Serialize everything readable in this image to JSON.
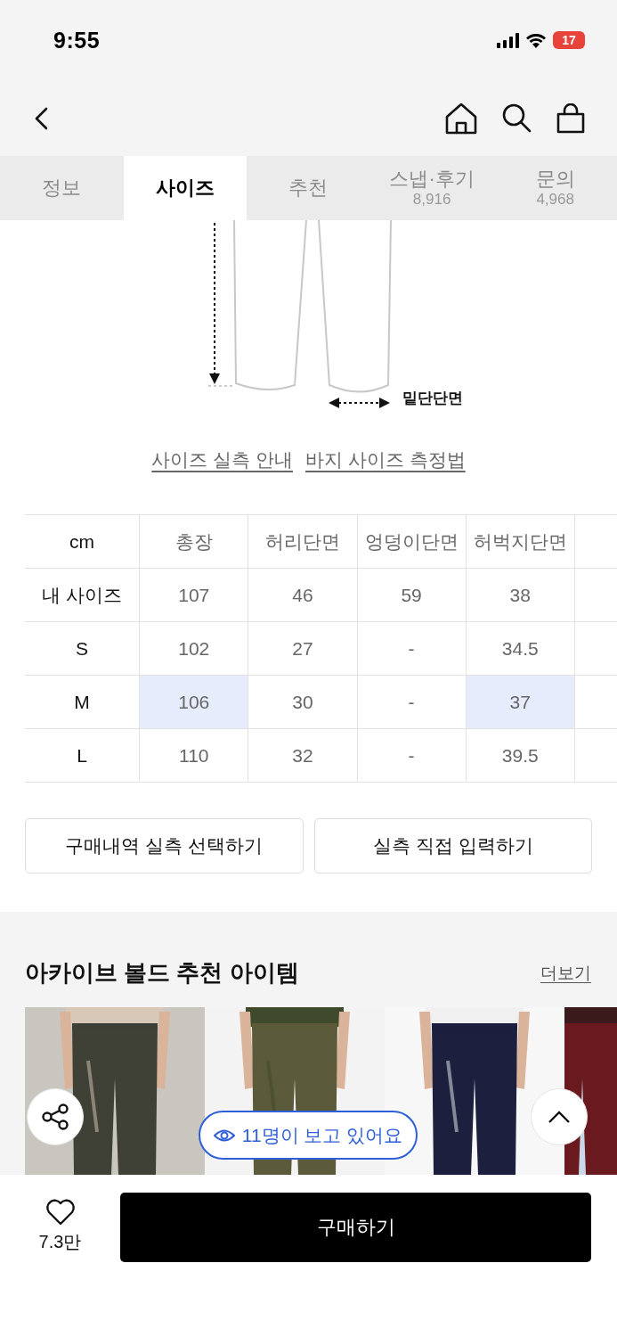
{
  "status_bar": {
    "time": "9:55",
    "battery": "17"
  },
  "tabs": [
    {
      "label": "정보",
      "selected": false
    },
    {
      "label": "사이즈",
      "selected": true
    },
    {
      "label": "추천",
      "selected": false
    },
    {
      "label": "스냅·후기",
      "count": "8,916",
      "selected": false
    },
    {
      "label": "문의",
      "count": "4,968",
      "selected": false
    }
  ],
  "diagram": {
    "label": "밑단단면"
  },
  "links": [
    "사이즈 실측 안내",
    "바지 사이즈 측정법"
  ],
  "size_table": {
    "corner": "cm",
    "columns": [
      "총장",
      "허리단면",
      "엉덩이단면",
      "허벅지단면"
    ],
    "rows": [
      {
        "label": "내 사이즈",
        "cells": [
          {
            "text": "107",
            "highlighted": false
          },
          {
            "text": "46",
            "highlighted": false
          },
          {
            "text": "59",
            "highlighted": false
          },
          {
            "text": "38",
            "highlighted": false
          }
        ]
      },
      {
        "label": "S",
        "cells": [
          {
            "text": "102",
            "highlighted": false
          },
          {
            "text": "27",
            "highlighted": false
          },
          {
            "text": "-",
            "highlighted": false
          },
          {
            "text": "34.5",
            "highlighted": false
          }
        ]
      },
      {
        "label": "M",
        "cells": [
          {
            "text": "106",
            "highlighted": true
          },
          {
            "text": "30",
            "highlighted": false
          },
          {
            "text": "-",
            "highlighted": false
          },
          {
            "text": "37",
            "highlighted": true
          }
        ]
      },
      {
        "label": "L",
        "cells": [
          {
            "text": "110",
            "highlighted": false
          },
          {
            "text": "32",
            "highlighted": false
          },
          {
            "text": "-",
            "highlighted": false
          },
          {
            "text": "39.5",
            "highlighted": false
          }
        ]
      }
    ]
  },
  "size_buttons": [
    "구매내역 실측 선택하기",
    "실측 직접 입력하기"
  ],
  "recommendations": {
    "title": "아카이브 볼드 추천 아이템",
    "more": "더보기"
  },
  "viewers": "11명이 보고 있어요",
  "likes": "7.3만",
  "buy_button": "구매하기"
}
